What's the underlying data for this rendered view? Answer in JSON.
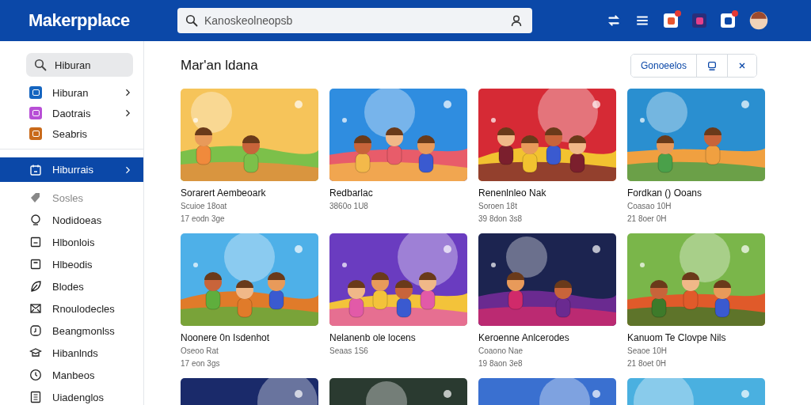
{
  "header": {
    "logo": "Makerpplace",
    "search": {
      "placeholder": "Kanoskeolneopsb"
    }
  },
  "sidebar": {
    "search": {
      "value": "Hiburan"
    },
    "apps": [
      {
        "label": "Hiburan",
        "color": "#1565c0",
        "expandable": true
      },
      {
        "label": "Daotrais",
        "color": "#b84fd6",
        "expandable": true
      },
      {
        "label": "Seabris",
        "color": "#c96a1b",
        "expandable": false
      }
    ],
    "items": [
      {
        "label": "Hiburrais",
        "selected": true,
        "disabled": false
      },
      {
        "label": "Sosles",
        "selected": false,
        "disabled": true
      },
      {
        "label": "Nodidoeas",
        "selected": false,
        "disabled": false
      },
      {
        "label": "Hlbonlois",
        "selected": false,
        "disabled": false
      },
      {
        "label": "Hlbeodis",
        "selected": false,
        "disabled": false
      },
      {
        "label": "Blodes",
        "selected": false,
        "disabled": false
      },
      {
        "label": "Rnoulodecles",
        "selected": false,
        "disabled": false
      },
      {
        "label": "Beangmonlss",
        "selected": false,
        "disabled": false
      },
      {
        "label": "Hibanlnds",
        "selected": false,
        "disabled": false
      },
      {
        "label": "Manbeos",
        "selected": false,
        "disabled": false
      },
      {
        "label": "Uiadenglos",
        "selected": false,
        "disabled": false
      }
    ]
  },
  "main": {
    "title": "Mar'an ldana",
    "actions": {
      "button": "Gonoeelos"
    },
    "cards": [
      {
        "kind": "game",
        "title": "Sorarert Aembeoark",
        "subtitle": "Scuioe 18oat",
        "meta": "17 eodn 3ge"
      },
      {
        "kind": "game",
        "title": "Redbarlac",
        "subtitle": "3860o 1U8"
      },
      {
        "kind": "game",
        "title": "Renenlnleo Nak",
        "subtitle": "Soroen 18t",
        "meta": "39 8don 3s8"
      },
      {
        "kind": "game",
        "title": "Fordkan () Ooans",
        "subtitle": "Coasao 10H",
        "meta": "21 8oer 0H"
      },
      {
        "kind": "game",
        "title": "Noonere 0n Isdenhot",
        "subtitle": "Oseoo Rat",
        "meta": "17 eon 3gs"
      },
      {
        "kind": "game",
        "title": "Nelanenb ole locens",
        "subtitle": "Seaas 1S6"
      },
      {
        "kind": "game",
        "title": "Keroenne Anlcerodes",
        "subtitle": "Coaono Nae",
        "meta": "19 8aon 3e8"
      },
      {
        "kind": "game",
        "title": "Kanuom Te Clovpe Nils",
        "subtitle": "Seaoe 10H",
        "meta": "21 8oet 0H"
      },
      {
        "kind": "picture"
      },
      {
        "kind": "picture"
      },
      {
        "kind": "picture"
      },
      {
        "kind": "picture"
      }
    ]
  }
}
